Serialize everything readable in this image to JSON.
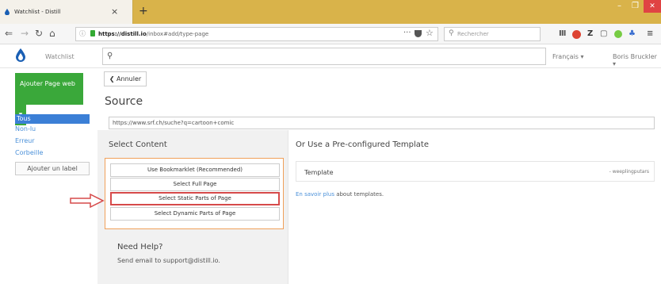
{
  "browser": {
    "tab_title": "Watchlist - Distill",
    "tab_close": "×",
    "new_tab": "+",
    "win_min": "–",
    "win_max": "❐",
    "win_close": "✕",
    "url_domain": "https://distill.io",
    "url_path": "/inbox#add/type-page",
    "search_placeholder": "Rechercher",
    "icons": [
      "back-icon",
      "forward-icon",
      "reload-icon",
      "home-icon",
      "info-icon",
      "lock-icon",
      "more-icon",
      "pocket-icon",
      "bookmark-star-icon",
      "search-icon",
      "library-icon",
      "extension-icons"
    ]
  },
  "app": {
    "name": "Watchlist",
    "language": "Français ▾",
    "user": "Boris Bruckler ▾",
    "accent_green": "#3aa83a",
    "accent_blue": "#3b7fd6",
    "highlight_red": "#d64a4a",
    "box_orange": "#f0a05a"
  },
  "sidebar": {
    "add_label": "Ajouter Page web",
    "add_dropdown": "▾",
    "items": [
      {
        "label": "Tous"
      },
      {
        "label": "Non-lu"
      },
      {
        "label": "Erreur"
      },
      {
        "label": "Corbeille"
      }
    ],
    "add_label_button": "Ajouter un label"
  },
  "main": {
    "back_label": "❮ Annuler",
    "title": "Source",
    "source_url": "https://www.srf.ch/suche?q=cartoon+comic",
    "select_content": {
      "title": "Select Content",
      "options": [
        "Use Bookmarklet (Recommended)",
        "Select Full Page",
        "Select Static Parts of Page",
        "Select Dynamic Parts of Page"
      ]
    },
    "help": {
      "title": "Need Help?",
      "text": "Send email to support@distill.io."
    },
    "template": {
      "title": "Or Use a Pre-configured Template",
      "label": "Template",
      "value": "- weeplingputars",
      "learn_link": "En savoir plus",
      "learn_rest": " about templates."
    }
  }
}
